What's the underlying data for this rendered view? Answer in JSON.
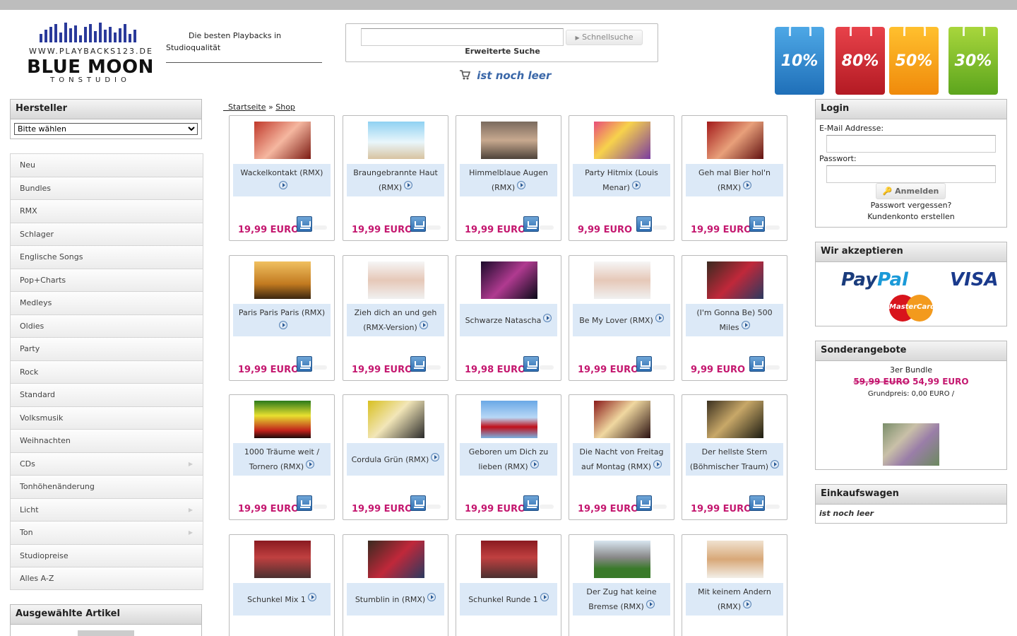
{
  "header": {
    "logo": {
      "url": "WWW.PLAYBACKS123.DE",
      "brand": "BLUE MOON",
      "sub": "TONSTUDIO"
    },
    "slogan_line1": "Die besten Playbacks in",
    "slogan_line2": "Studioqualität",
    "search": {
      "value": "",
      "button_label": "Schnellsuche",
      "advanced_label": "Erweiterte Suche"
    },
    "cart_status": "ist noch leer",
    "promo_bags": [
      "10%",
      "80%",
      "50%",
      "30%"
    ]
  },
  "left": {
    "manufacturer": {
      "title": "Hersteller",
      "selected": "Bitte wählen"
    },
    "categories": [
      {
        "label": "Neu",
        "submenu": false
      },
      {
        "label": "Bundles",
        "submenu": false
      },
      {
        "label": "RMX",
        "submenu": false
      },
      {
        "label": "Schlager",
        "submenu": false
      },
      {
        "label": "Englische Songs",
        "submenu": false
      },
      {
        "label": "Pop+Charts",
        "submenu": false
      },
      {
        "label": "Medleys",
        "submenu": false
      },
      {
        "label": "Oldies",
        "submenu": false
      },
      {
        "label": "Party",
        "submenu": false
      },
      {
        "label": "Rock",
        "submenu": false
      },
      {
        "label": "Standard",
        "submenu": false
      },
      {
        "label": "Volksmusik",
        "submenu": false
      },
      {
        "label": "Weihnachten",
        "submenu": false
      },
      {
        "label": "CDs",
        "submenu": true
      },
      {
        "label": "Tonhöhenänderung",
        "submenu": false
      },
      {
        "label": "Licht",
        "submenu": true
      },
      {
        "label": "Ton",
        "submenu": true
      },
      {
        "label": "Studiopreise",
        "submenu": false
      },
      {
        "label": "Alles A-Z",
        "submenu": false
      }
    ],
    "featured_title": "Ausgewählte Artikel"
  },
  "breadcrumb": {
    "home": "Startseite",
    "sep": "»",
    "current": "Shop"
  },
  "products": [
    {
      "name": "Wackelkontakt (RMX)",
      "price": "19,99 EURO"
    },
    {
      "name": "Braungebrannte Haut (RMX)",
      "price": "19,99 EURO"
    },
    {
      "name": "Himmelblaue Augen (RMX)",
      "price": "19,99 EURO"
    },
    {
      "name": "Party Hitmix (Louis Menar)",
      "price": "9,99 EURO"
    },
    {
      "name": "Geh mal Bier hol'n (RMX)",
      "price": "19,99 EURO"
    },
    {
      "name": "Paris Paris Paris (RMX)",
      "price": "19,99 EURO"
    },
    {
      "name": "Zieh dich an und geh (RMX-Version)",
      "price": "19,99 EURO"
    },
    {
      "name": "Schwarze Natascha",
      "price": "19,98 EURO"
    },
    {
      "name": "Be My Lover (RMX)",
      "price": "19,99 EURO"
    },
    {
      "name": "(I'm Gonna Be) 500 Miles",
      "price": "9,99 EURO"
    },
    {
      "name": "1000 Träume weit / Tornero (RMX)",
      "price": "19,99 EURO"
    },
    {
      "name": "Cordula Grün (RMX)",
      "price": "19,99 EURO"
    },
    {
      "name": "Geboren um Dich zu lieben (RMX)",
      "price": "19,99 EURO"
    },
    {
      "name": "Die Nacht von Freitag auf Montag (RMX)",
      "price": "19,99 EURO"
    },
    {
      "name": "Der hellste Stern (Böhmischer Traum)",
      "price": "19,99 EURO"
    },
    {
      "name": "Schunkel Mix 1",
      "price": ""
    },
    {
      "name": "Stumblin in (RMX)",
      "price": ""
    },
    {
      "name": "Schunkel Runde 1",
      "price": ""
    },
    {
      "name": "Der Zug hat keine Bremse (RMX)",
      "price": ""
    },
    {
      "name": "Mit keinem Andern (RMX)",
      "price": ""
    }
  ],
  "right": {
    "login": {
      "title": "Login",
      "email_label": "E-Mail Addresse:",
      "password_label": "Passwort:",
      "button": "Anmelden",
      "forgot": "Passwort vergessen?",
      "register": "Kundenkonto erstellen"
    },
    "accept": {
      "title": "Wir akzeptieren",
      "paypal": "Pay",
      "paypal2": "Pal",
      "visa": "VISA",
      "mastercard": "MasterCard"
    },
    "special": {
      "title": "Sonderangebote",
      "product": "3er Bundle",
      "old_price": "59,99 EURO",
      "new_price": "54,99 EURO",
      "base_price": "Grundpreis: 0,00 EURO /"
    },
    "cart": {
      "title": "Einkaufswagen",
      "status": "ist noch leer"
    }
  },
  "colors": {
    "price": "#c4176f",
    "accent_blue": "#3a67a8",
    "name_bg": "#dce9f7"
  }
}
